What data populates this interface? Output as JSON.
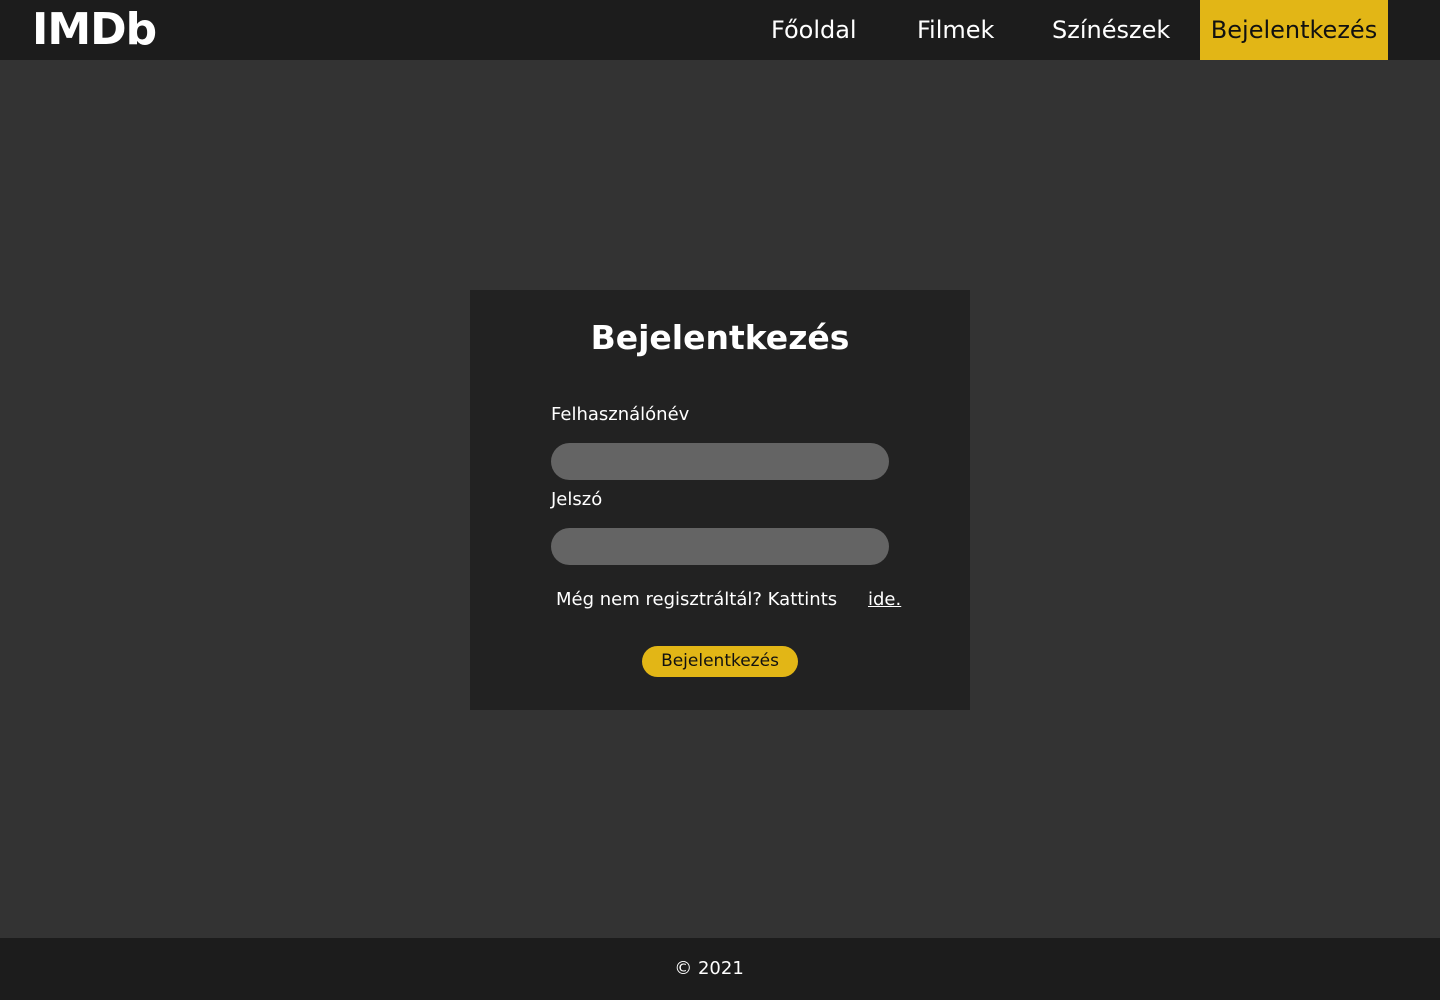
{
  "header": {
    "logo": "IMDb",
    "nav": {
      "home": "Főoldal",
      "movies": "Filmek",
      "actors": "Színészek",
      "login": "Bejelentkezés"
    },
    "active_item": "login"
  },
  "login_form": {
    "title": "Bejelentkezés",
    "username_label": "Felhasználónév",
    "username_value": "",
    "password_label": "Jelszó",
    "password_value": "",
    "register_prompt": "Még nem regisztráltál? Kattints",
    "register_link": "ide.",
    "submit_label": "Bejelentkezés"
  },
  "footer": {
    "copyright": "© 2021"
  },
  "colors": {
    "accent": "#e2b616",
    "navbar": "#1c1c1c",
    "page_background": "#333333",
    "card_background": "#222222",
    "input_background": "#646464"
  }
}
